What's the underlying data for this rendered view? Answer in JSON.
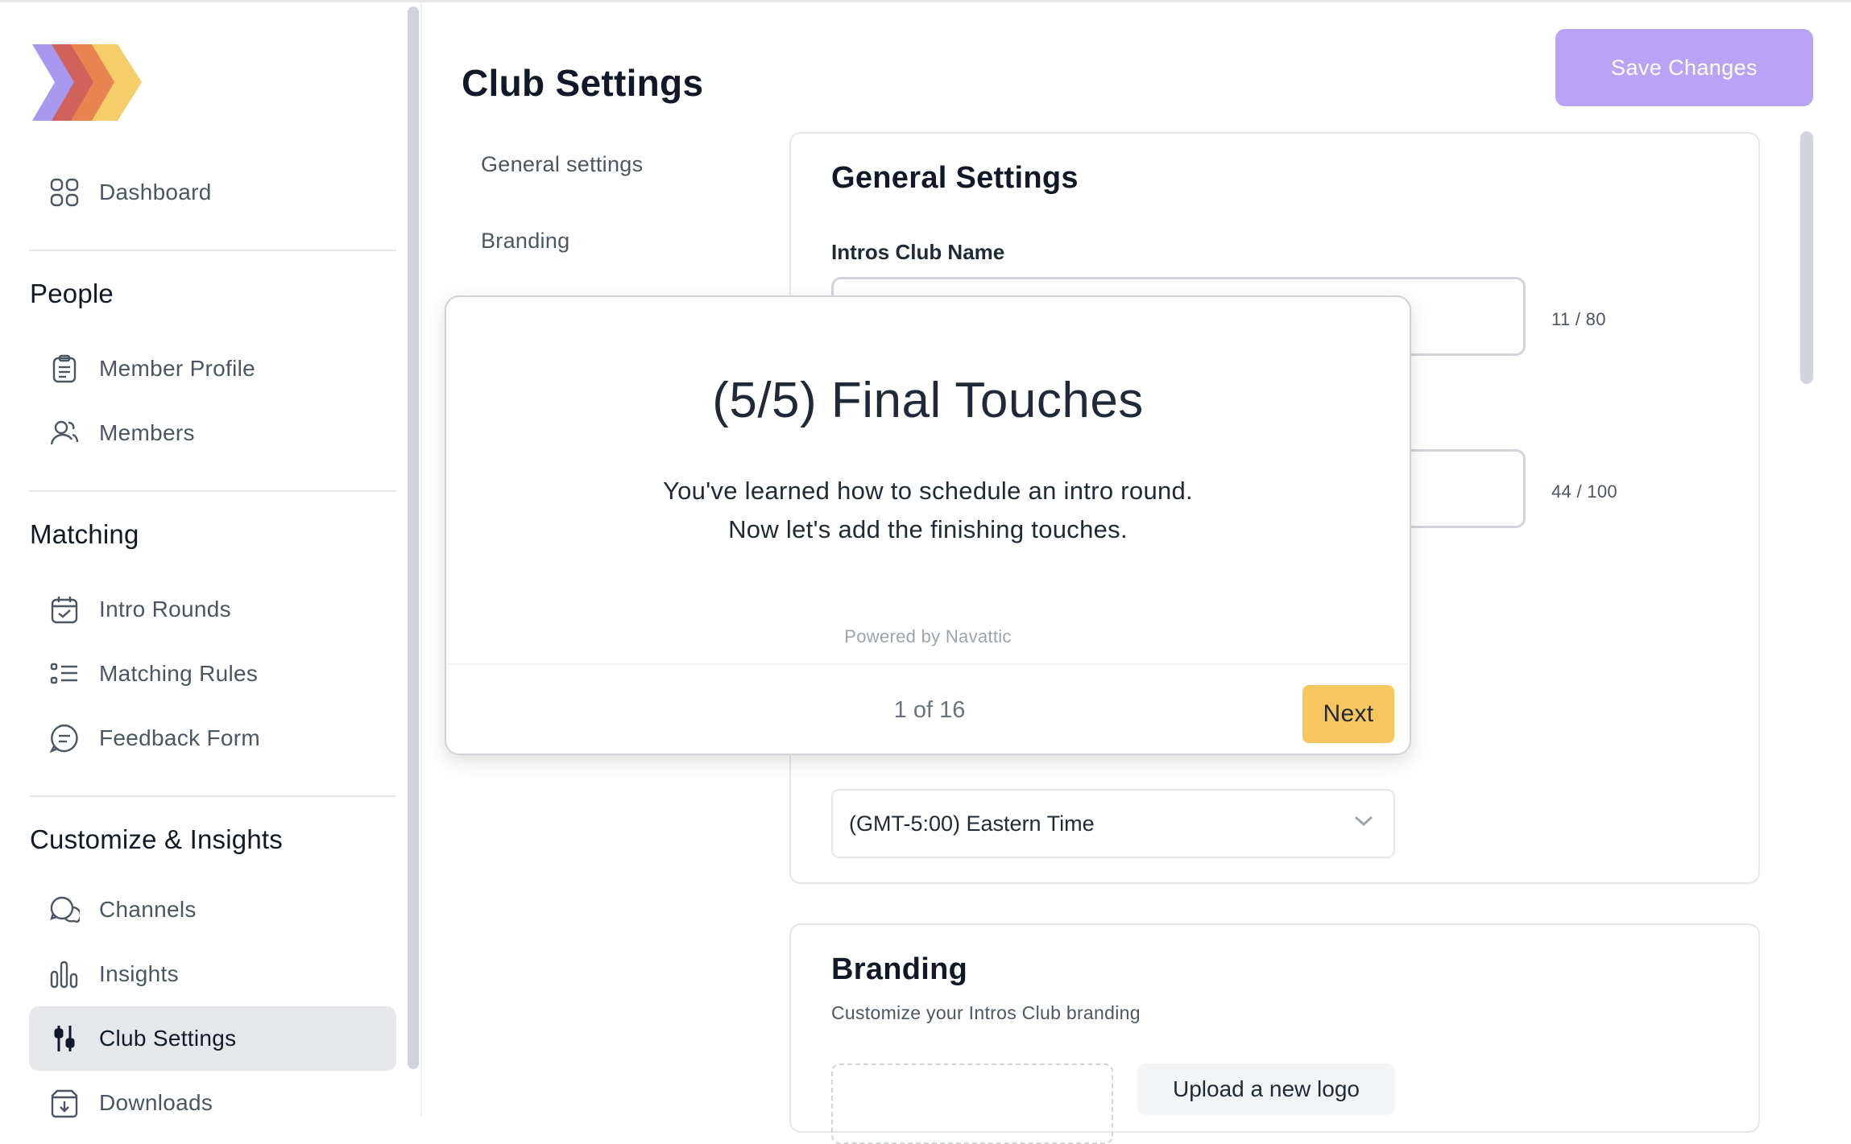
{
  "sidebar": {
    "dashboard": "Dashboard",
    "people_title": "People",
    "member_profile": "Member Profile",
    "members": "Members",
    "matching_title": "Matching",
    "intro_rounds": "Intro Rounds",
    "matching_rules": "Matching Rules",
    "feedback_form": "Feedback Form",
    "customize_title": "Customize & Insights",
    "channels": "Channels",
    "insights": "Insights",
    "club_settings": "Club Settings",
    "downloads": "Downloads"
  },
  "header": {
    "title": "Club Settings",
    "save_label": "Save Changes"
  },
  "subnav": {
    "general": "General settings",
    "branding": "Branding"
  },
  "general_card": {
    "title": "General Settings",
    "club_name_label": "Intros Club Name",
    "club_name_counter": "11 / 80",
    "second_counter": "44 / 100",
    "timezone": "(GMT-5:00) Eastern Time"
  },
  "branding_card": {
    "title": "Branding",
    "subtitle": "Customize your Intros Club branding",
    "upload_label": "Upload a new logo"
  },
  "modal": {
    "title": "(5/5) Final Touches",
    "line1": "You've learned how to schedule an intro round.",
    "line2": "Now let's add the finishing touches.",
    "powered": "Powered by Navattic",
    "step": "1 of 16",
    "next_label": "Next"
  },
  "colors": {
    "accent": "#b9a3f5",
    "next": "#f7c65e",
    "logo": [
      "#a898f0",
      "#d1625a",
      "#e8844f",
      "#f5cd6a"
    ]
  }
}
